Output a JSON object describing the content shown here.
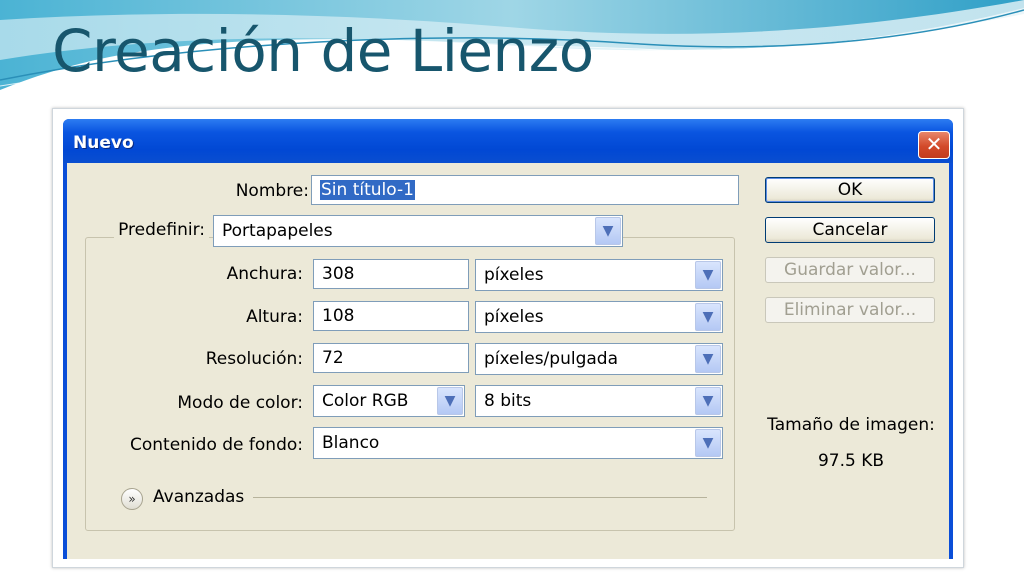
{
  "slide": {
    "title": "Creación de Lienzo"
  },
  "dialog": {
    "title": "Nuevo",
    "close_icon": "close-icon",
    "name": {
      "label": "Nombre:",
      "value": "Sin título-1"
    },
    "preset": {
      "label": "Predefinir:",
      "value": "Portapapeles"
    },
    "width": {
      "label": "Anchura:",
      "value": "308",
      "unit": "píxeles"
    },
    "height": {
      "label": "Altura:",
      "value": "108",
      "unit": "píxeles"
    },
    "resolution": {
      "label": "Resolución:",
      "value": "72",
      "unit": "píxeles/pulgada"
    },
    "color_mode": {
      "label": "Modo de color:",
      "value": "Color RGB",
      "bits": "8 bits"
    },
    "background": {
      "label": "Contenido de fondo:",
      "value": "Blanco"
    },
    "advanced": {
      "label": "Avanzadas",
      "icon": "chevron-double-down-icon"
    },
    "buttons": {
      "ok": "OK",
      "cancel": "Cancelar",
      "save_preset": "Guardar valor...",
      "delete_preset": "Eliminar valor..."
    },
    "image_size": {
      "label": "Tamaño de imagen:",
      "value": "97.5 KB"
    }
  },
  "colors": {
    "title_blue": "#17566d",
    "xp_titlebar": "#0a55e0",
    "dialog_bg": "#ece9d8"
  }
}
